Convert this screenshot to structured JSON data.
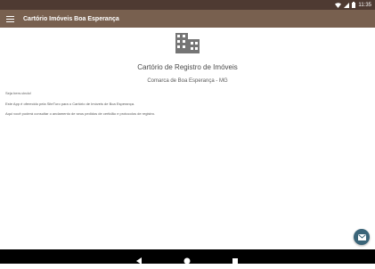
{
  "status_bar": {
    "time": "11:35",
    "icons": [
      "wifi-icon",
      "cellular-signal-icon",
      "battery-icon"
    ]
  },
  "app_bar": {
    "title": "Cartório Imóveis Boa Esperança",
    "menu_icon": "hamburger-menu-icon",
    "color": "#78604f"
  },
  "main": {
    "header_icon": "building-icon",
    "title": "Cartório de Registro de Imóveis",
    "subtitle": "Comarca de Boa Esperança - MG",
    "paragraphs": [
      "Seja bem-vindo!",
      "Este App é oferecido pela SiteTuro para o Cartório de Imóveis de Boa Esperança.",
      "Aqui você poderá consultar o andamento de seus pedidos de certidão e protocolos de registro."
    ]
  },
  "fab": {
    "icon": "email-icon",
    "color": "#3a6478"
  },
  "nav_bar": {
    "buttons": [
      "back-icon",
      "home-icon",
      "recents-icon"
    ]
  }
}
